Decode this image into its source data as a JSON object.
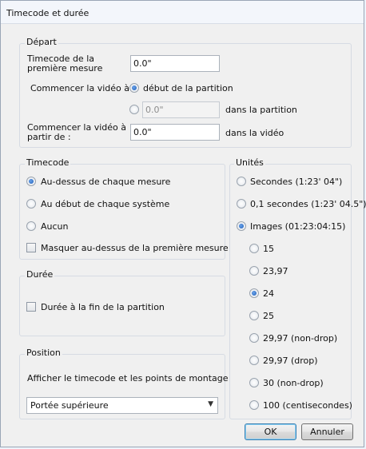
{
  "dialog": {
    "title": "Timecode et durée"
  },
  "depart": {
    "legend": "Départ",
    "first_measure_label": "Timecode de la première mesure",
    "first_measure_value": "0.0\"",
    "start_video_label": "Commencer la vidéo à :",
    "option_start_score": "début de la partition",
    "option_custom_value": "0.0\"",
    "option_custom_suffix": "dans la partition",
    "start_from_label": "Commencer la vidéo à partir de :",
    "start_from_value": "0.0\"",
    "start_from_suffix": "dans la vidéo"
  },
  "timecode": {
    "legend": "Timecode",
    "options": [
      "Au-dessus de chaque mesure",
      "Au début de chaque système",
      "Aucun"
    ],
    "selected": "Au-dessus de chaque mesure",
    "hide_first_label": "Masquer au-dessus de la première mesure"
  },
  "duree": {
    "legend": "Durée",
    "end_checkbox_label": "Durée à la fin de la partition"
  },
  "position": {
    "legend": "Position",
    "label": "Afficher le timecode et les points de montage sur :",
    "selected": "Portée supérieure"
  },
  "unites": {
    "legend": "Unités",
    "options": [
      "Secondes (1:23' 04\")",
      "0,1 secondes (1:23' 04.5\")",
      "Images (01:23:04:15)"
    ],
    "selected": "Images (01:23:04:15)",
    "frame_rates": [
      "15",
      "23,97",
      "24",
      "25",
      "29,97 (non-drop)",
      "29,97 (drop)",
      "30 (non-drop)",
      "100 (centisecondes)"
    ],
    "selected_rate": "24"
  },
  "buttons": {
    "ok": "OK",
    "cancel": "Annuler"
  }
}
